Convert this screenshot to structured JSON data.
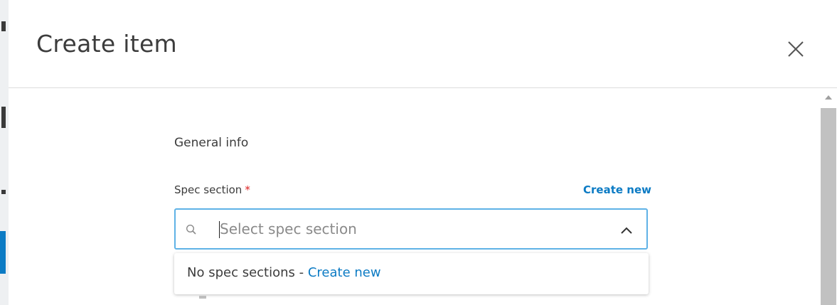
{
  "dialog": {
    "title": "Create item"
  },
  "form": {
    "section_title": "General info",
    "spec_section": {
      "label": "Spec section",
      "required_mark": "*",
      "create_new_label": "Create new",
      "placeholder": "Select spec section",
      "value": ""
    },
    "dropdown": {
      "empty_text": "No spec sections - ",
      "empty_link": "Create new"
    }
  },
  "colors": {
    "accent": "#0c7bc4",
    "focus_border": "#5fb2e6",
    "required": "#dd2222",
    "text": "#3c3c3c"
  },
  "icons": {
    "close": "close-icon",
    "search": "search-icon",
    "chevron": "chevron-up-icon",
    "scroll_up": "scroll-up-arrow-icon"
  }
}
